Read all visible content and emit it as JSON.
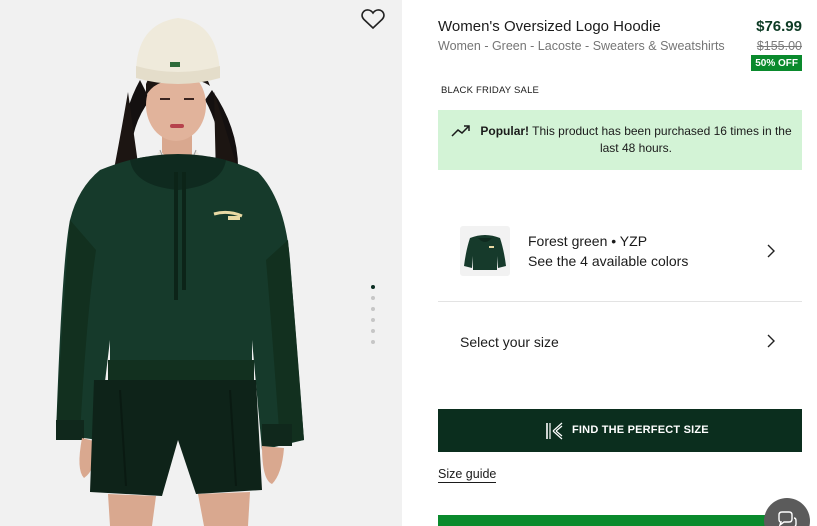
{
  "product": {
    "title": "Women's Oversized Logo Hoodie",
    "subtitle": "Women - Green - Lacoste - Sweaters & Sweatshirts",
    "price": "$76.99",
    "original_price": "$155.00",
    "discount_badge": "50% OFF",
    "sale_label": "BLACK FRIDAY SALE"
  },
  "popular": {
    "strong": "Popular!",
    "text": " This product has been purchased 16 times in the last 48 hours."
  },
  "color": {
    "line1": "Forest green • YZP",
    "line2": "See the 4 available colors"
  },
  "size": {
    "label": "Select your size"
  },
  "fit_button": {
    "label": "FIND THE PERFECT SIZE"
  },
  "size_guide": {
    "label": "Size guide"
  },
  "gallery": {
    "image_count": 6,
    "active_index": 0
  },
  "colors": {
    "brand_green": "#0b2e1e",
    "sale_green": "#0a8a2d",
    "popular_bg": "#d3f3d6"
  },
  "icons": {
    "wishlist": "heart-outline-icon",
    "trend": "trending-up-icon",
    "chevron": "chevron-right-icon",
    "fit": "kleep-k-icon",
    "chat": "chat-bubbles-icon"
  }
}
